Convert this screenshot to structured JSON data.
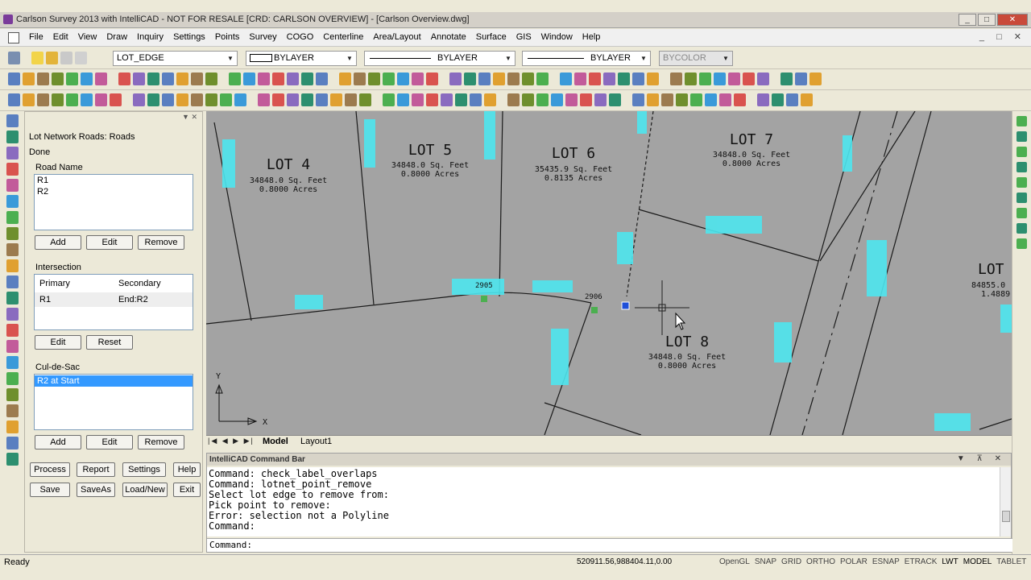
{
  "window": {
    "title": "Carlson Survey 2013 with IntelliCAD - NOT FOR RESALE [CRD: CARLSON OVERVIEW] - [Carlson Overview.dwg]",
    "minimize": "_",
    "maximize": "□",
    "close": "✕"
  },
  "menu": {
    "items": [
      "File",
      "Edit",
      "View",
      "Draw",
      "Inquiry",
      "Settings",
      "Points",
      "Survey",
      "COGO",
      "Centerline",
      "Area/Layout",
      "Annotate",
      "Surface",
      "GIS",
      "Window",
      "Help"
    ],
    "doc_controls": "_ □ ✕"
  },
  "properties_bar": {
    "layer": "LOT_EDGE",
    "color": "BYLAYER",
    "linetype": "BYLAYER",
    "lineweight": "BYLAYER",
    "plotstyle": "BYCOLOR"
  },
  "panel": {
    "heading": "Lot Network Roads: Roads",
    "done": "Done",
    "road_name_label": "Road Name",
    "roads": [
      "R1",
      "R2"
    ],
    "road_buttons": {
      "add": "Add",
      "edit": "Edit",
      "remove": "Remove"
    },
    "intersection_label": "Intersection",
    "intersection_headers": {
      "primary": "Primary",
      "secondary": "Secondary"
    },
    "intersection_row": {
      "primary": "R1",
      "secondary": "End:R2"
    },
    "intersection_buttons": {
      "edit": "Edit",
      "reset": "Reset"
    },
    "culdesac_label": "Cul-de-Sac",
    "culdesac_items": [
      "R2 at Start"
    ],
    "culdesac_buttons": {
      "add": "Add",
      "edit": "Edit",
      "remove": "Remove"
    },
    "actions": {
      "process": "Process",
      "report": "Report",
      "settings": "Settings",
      "help": "Help",
      "save": "Save",
      "saveas": "SaveAs",
      "loadnew": "Load/New",
      "exit": "Exit"
    }
  },
  "drawing": {
    "lots": [
      {
        "name": "LOT 4",
        "area": "34848.0 Sq. Feet",
        "acres": "0.8000 Acres"
      },
      {
        "name": "LOT 5",
        "area": "34848.0 Sq. Feet",
        "acres": "0.8000 Acres"
      },
      {
        "name": "LOT 6",
        "area": "35435.9 Sq. Feet",
        "acres": "0.8135 Acres"
      },
      {
        "name": "LOT 7",
        "area": "34848.0 Sq. Feet",
        "acres": "0.8000 Acres"
      },
      {
        "name": "LOT 8",
        "area": "34848.0 Sq. Feet",
        "acres": "0.8000 Acres"
      },
      {
        "name": "LOT",
        "area": "84855.0",
        "acres": "1.4889"
      }
    ],
    "points": [
      "2905",
      "2906"
    ],
    "axis_y": "Y",
    "axis_x": "X"
  },
  "tabs": {
    "model": "Model",
    "layout": "Layout1"
  },
  "command_bar": {
    "title": "IntelliCAD Command Bar",
    "history": [
      "Command: check_label_overlaps",
      "Command: lotnet_point_remove",
      "Select lot edge to remove from:",
      "Pick point to remove:",
      "Error: selection not a Polyline",
      "Command:"
    ],
    "prompt": "Command:"
  },
  "status": {
    "ready": "Ready",
    "coords": "520911.56,988404.11,0.00",
    "toggles": [
      "OpenGL",
      "SNAP",
      "GRID",
      "ORTHO",
      "POLAR",
      "ESNAP",
      "ETRACK",
      "LWT",
      "MODEL",
      "TABLET"
    ]
  }
}
